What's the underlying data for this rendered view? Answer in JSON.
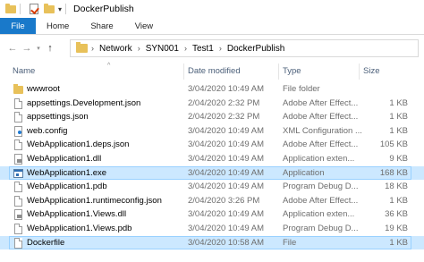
{
  "window": {
    "title": "DockerPublish"
  },
  "ribbon": {
    "tabs": [
      "File",
      "Home",
      "Share",
      "View"
    ]
  },
  "address": {
    "crumbs": [
      "Network",
      "SYN001",
      "Test1",
      "DockerPublish"
    ]
  },
  "columns": {
    "name": "Name",
    "date": "Date modified",
    "type": "Type",
    "size": "Size"
  },
  "files": [
    {
      "name": "wwwroot",
      "date": "3/04/2020 10:49 AM",
      "type": "File folder",
      "size": "",
      "icon": "folder-icon"
    },
    {
      "name": "appsettings.Development.json",
      "date": "2/04/2020 2:32 PM",
      "type": "Adobe After Effect...",
      "size": "1 KB",
      "icon": "json-file-icon"
    },
    {
      "name": "appsettings.json",
      "date": "2/04/2020 2:32 PM",
      "type": "Adobe After Effect...",
      "size": "1 KB",
      "icon": "json-file-icon"
    },
    {
      "name": "web.config",
      "date": "3/04/2020 10:49 AM",
      "type": "XML Configuration ...",
      "size": "1 KB",
      "icon": "config-file-icon"
    },
    {
      "name": "WebApplication1.deps.json",
      "date": "3/04/2020 10:49 AM",
      "type": "Adobe After Effect...",
      "size": "105 KB",
      "icon": "json-file-icon"
    },
    {
      "name": "WebApplication1.dll",
      "date": "3/04/2020 10:49 AM",
      "type": "Application exten...",
      "size": "9 KB",
      "icon": "dll-file-icon"
    },
    {
      "name": "WebApplication1.exe",
      "date": "3/04/2020 10:49 AM",
      "type": "Application",
      "size": "168 KB",
      "icon": "exe-file-icon"
    },
    {
      "name": "WebApplication1.pdb",
      "date": "3/04/2020 10:49 AM",
      "type": "Program Debug D...",
      "size": "18 KB",
      "icon": "pdb-file-icon"
    },
    {
      "name": "WebApplication1.runtimeconfig.json",
      "date": "2/04/2020 3:26 PM",
      "type": "Adobe After Effect...",
      "size": "1 KB",
      "icon": "json-file-icon"
    },
    {
      "name": "WebApplication1.Views.dll",
      "date": "3/04/2020 10:49 AM",
      "type": "Application exten...",
      "size": "36 KB",
      "icon": "dll-file-icon"
    },
    {
      "name": "WebApplication1.Views.pdb",
      "date": "3/04/2020 10:49 AM",
      "type": "Program Debug D...",
      "size": "19 KB",
      "icon": "pdb-file-icon"
    },
    {
      "name": "Dockerfile",
      "date": "3/04/2020 10:58 AM",
      "type": "File",
      "size": "1 KB",
      "icon": "file-icon"
    }
  ]
}
